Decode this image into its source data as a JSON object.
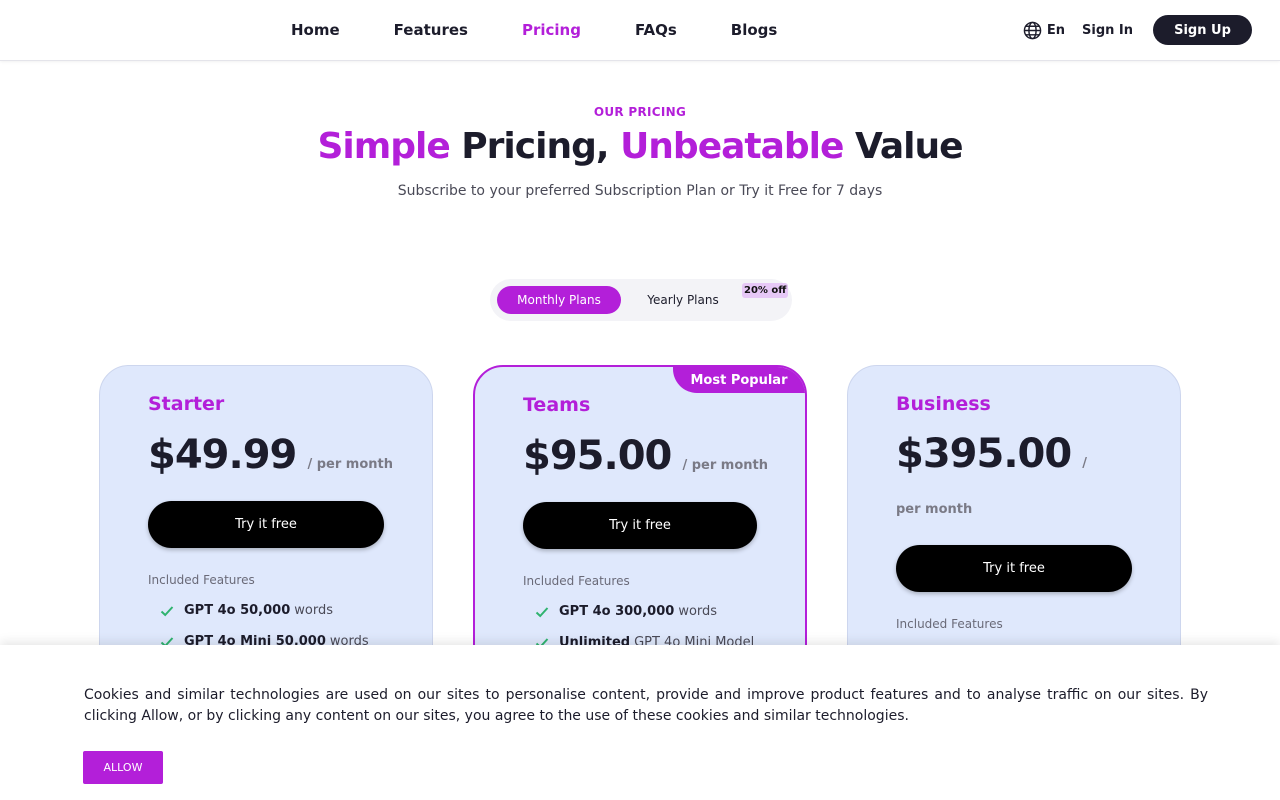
{
  "nav": {
    "links": [
      {
        "label": "Home",
        "active": false
      },
      {
        "label": "Features",
        "active": false
      },
      {
        "label": "Pricing",
        "active": true
      },
      {
        "label": "FAQs",
        "active": false
      },
      {
        "label": "Blogs",
        "active": false
      }
    ],
    "language": "En",
    "sign_in": "Sign In",
    "sign_up": "Sign Up"
  },
  "hero": {
    "eyebrow": "OUR PRICING",
    "title_1": "Simple",
    "title_2": " Pricing, ",
    "title_3": "Unbeatable",
    "title_4": " Value",
    "subtitle": "Subscribe to your preferred Subscription Plan or Try it Free for 7 days"
  },
  "billing_toggle": {
    "monthly": "Monthly Plans",
    "yearly": "Yearly Plans",
    "discount": "20% off",
    "selected": "monthly"
  },
  "plans": [
    {
      "name": "Starter",
      "price": "$49.99",
      "period": "/ per month",
      "cta": "Try it free",
      "features_label": "Included Features",
      "features": [
        {
          "bold": "GPT 4o 50,000",
          "text": "words"
        },
        {
          "bold": "GPT 4o Mini 50,000",
          "text": "words"
        }
      ]
    },
    {
      "name": "Teams",
      "badge": "Most Popular",
      "price": "$95.00",
      "period": "/ per month",
      "cta": "Try it free",
      "features_label": "Included Features",
      "features": [
        {
          "bold": "GPT 4o 300,000",
          "text": "words"
        },
        {
          "bold": "Unlimited",
          "text": "GPT 4o Mini Model"
        }
      ]
    },
    {
      "name": "Business",
      "price": "$395.00",
      "period": "/ per month",
      "cta": "Try it free",
      "features_label": "Included Features",
      "features": []
    }
  ],
  "cookie_banner": {
    "text": "Cookies and similar technologies are used on our sites to personalise content, provide and improve product features and to analyse traffic on our sites. By clicking Allow, or by clicking any content on our sites, you agree to the use of these cookies and similar technologies.",
    "allow": "ALLOW"
  },
  "colors": {
    "accent": "#b31fd9",
    "dark": "#1c1c2b",
    "card_bg": "#dfe8fc",
    "check": "#2fb36f"
  },
  "icons": {
    "language": "globe-icon",
    "feature": "check-icon"
  }
}
